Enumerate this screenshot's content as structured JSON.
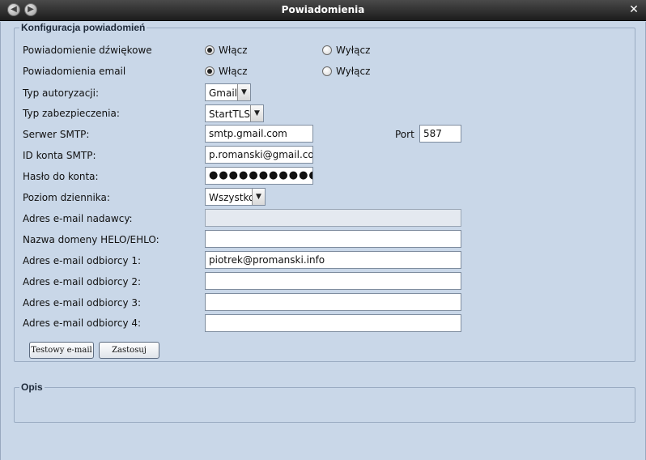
{
  "window": {
    "title": "Powiadomienia"
  },
  "config": {
    "legend": "Konfiguracja powiadomień",
    "sound": {
      "label": "Powiadomienie dźwiękowe",
      "on": "Włącz",
      "off": "Wyłącz",
      "selected": "on"
    },
    "email": {
      "label": "Powiadomienia email",
      "on": "Włącz",
      "off": "Wyłącz",
      "selected": "on"
    },
    "auth_type": {
      "label": "Typ autoryzacji:",
      "value": "Gmail"
    },
    "security_type": {
      "label": "Typ zabezpieczenia:",
      "value": "StartTLS"
    },
    "smtp_server": {
      "label": "Serwer SMTP:",
      "value": "smtp.gmail.com"
    },
    "port": {
      "label": "Port",
      "value": "587"
    },
    "smtp_account": {
      "label": "ID konta SMTP:",
      "value": "p.romanski@gmail.com"
    },
    "password": {
      "label": "Hasło do konta:",
      "value": "●●●●●●●●●●●●●●"
    },
    "log_level": {
      "label": "Poziom dziennika:",
      "value": "Wszystko"
    },
    "sender": {
      "label": "Adres e-mail nadawcy:",
      "value": ""
    },
    "helo": {
      "label": "Nazwa domeny HELO/EHLO:",
      "value": ""
    },
    "recipient1": {
      "label": "Adres e-mail odbiorcy 1:",
      "value": "piotrek@promanski.info"
    },
    "recipient2": {
      "label": "Adres e-mail odbiorcy 2:",
      "value": ""
    },
    "recipient3": {
      "label": "Adres e-mail odbiorcy 3:",
      "value": ""
    },
    "recipient4": {
      "label": "Adres e-mail odbiorcy 4:",
      "value": ""
    },
    "test_button": "Testowy e-mail",
    "apply_button": "Zastosuj"
  },
  "description": {
    "legend": "Opis"
  }
}
